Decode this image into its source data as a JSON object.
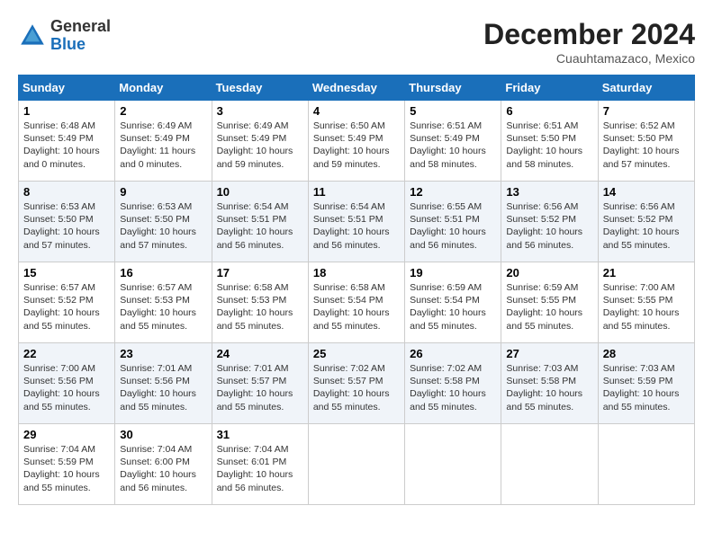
{
  "header": {
    "logo_line1": "General",
    "logo_line2": "Blue",
    "month_title": "December 2024",
    "location": "Cuauhtamazaco, Mexico"
  },
  "weekdays": [
    "Sunday",
    "Monday",
    "Tuesday",
    "Wednesday",
    "Thursday",
    "Friday",
    "Saturday"
  ],
  "weeks": [
    [
      {
        "day": "1",
        "sunrise": "6:48 AM",
        "sunset": "5:49 PM",
        "daylight": "10 hours and 0 minutes."
      },
      {
        "day": "2",
        "sunrise": "6:49 AM",
        "sunset": "5:49 PM",
        "daylight": "11 hours and 0 minutes."
      },
      {
        "day": "3",
        "sunrise": "6:49 AM",
        "sunset": "5:49 PM",
        "daylight": "10 hours and 59 minutes."
      },
      {
        "day": "4",
        "sunrise": "6:50 AM",
        "sunset": "5:49 PM",
        "daylight": "10 hours and 59 minutes."
      },
      {
        "day": "5",
        "sunrise": "6:51 AM",
        "sunset": "5:49 PM",
        "daylight": "10 hours and 58 minutes."
      },
      {
        "day": "6",
        "sunrise": "6:51 AM",
        "sunset": "5:50 PM",
        "daylight": "10 hours and 58 minutes."
      },
      {
        "day": "7",
        "sunrise": "6:52 AM",
        "sunset": "5:50 PM",
        "daylight": "10 hours and 57 minutes."
      }
    ],
    [
      {
        "day": "8",
        "sunrise": "6:53 AM",
        "sunset": "5:50 PM",
        "daylight": "10 hours and 57 minutes."
      },
      {
        "day": "9",
        "sunrise": "6:53 AM",
        "sunset": "5:50 PM",
        "daylight": "10 hours and 57 minutes."
      },
      {
        "day": "10",
        "sunrise": "6:54 AM",
        "sunset": "5:51 PM",
        "daylight": "10 hours and 56 minutes."
      },
      {
        "day": "11",
        "sunrise": "6:54 AM",
        "sunset": "5:51 PM",
        "daylight": "10 hours and 56 minutes."
      },
      {
        "day": "12",
        "sunrise": "6:55 AM",
        "sunset": "5:51 PM",
        "daylight": "10 hours and 56 minutes."
      },
      {
        "day": "13",
        "sunrise": "6:56 AM",
        "sunset": "5:52 PM",
        "daylight": "10 hours and 56 minutes."
      },
      {
        "day": "14",
        "sunrise": "6:56 AM",
        "sunset": "5:52 PM",
        "daylight": "10 hours and 55 minutes."
      }
    ],
    [
      {
        "day": "15",
        "sunrise": "6:57 AM",
        "sunset": "5:52 PM",
        "daylight": "10 hours and 55 minutes."
      },
      {
        "day": "16",
        "sunrise": "6:57 AM",
        "sunset": "5:53 PM",
        "daylight": "10 hours and 55 minutes."
      },
      {
        "day": "17",
        "sunrise": "6:58 AM",
        "sunset": "5:53 PM",
        "daylight": "10 hours and 55 minutes."
      },
      {
        "day": "18",
        "sunrise": "6:58 AM",
        "sunset": "5:54 PM",
        "daylight": "10 hours and 55 minutes."
      },
      {
        "day": "19",
        "sunrise": "6:59 AM",
        "sunset": "5:54 PM",
        "daylight": "10 hours and 55 minutes."
      },
      {
        "day": "20",
        "sunrise": "6:59 AM",
        "sunset": "5:55 PM",
        "daylight": "10 hours and 55 minutes."
      },
      {
        "day": "21",
        "sunrise": "7:00 AM",
        "sunset": "5:55 PM",
        "daylight": "10 hours and 55 minutes."
      }
    ],
    [
      {
        "day": "22",
        "sunrise": "7:00 AM",
        "sunset": "5:56 PM",
        "daylight": "10 hours and 55 minutes."
      },
      {
        "day": "23",
        "sunrise": "7:01 AM",
        "sunset": "5:56 PM",
        "daylight": "10 hours and 55 minutes."
      },
      {
        "day": "24",
        "sunrise": "7:01 AM",
        "sunset": "5:57 PM",
        "daylight": "10 hours and 55 minutes."
      },
      {
        "day": "25",
        "sunrise": "7:02 AM",
        "sunset": "5:57 PM",
        "daylight": "10 hours and 55 minutes."
      },
      {
        "day": "26",
        "sunrise": "7:02 AM",
        "sunset": "5:58 PM",
        "daylight": "10 hours and 55 minutes."
      },
      {
        "day": "27",
        "sunrise": "7:03 AM",
        "sunset": "5:58 PM",
        "daylight": "10 hours and 55 minutes."
      },
      {
        "day": "28",
        "sunrise": "7:03 AM",
        "sunset": "5:59 PM",
        "daylight": "10 hours and 55 minutes."
      }
    ],
    [
      {
        "day": "29",
        "sunrise": "7:04 AM",
        "sunset": "5:59 PM",
        "daylight": "10 hours and 55 minutes."
      },
      {
        "day": "30",
        "sunrise": "7:04 AM",
        "sunset": "6:00 PM",
        "daylight": "10 hours and 56 minutes."
      },
      {
        "day": "31",
        "sunrise": "7:04 AM",
        "sunset": "6:01 PM",
        "daylight": "10 hours and 56 minutes."
      },
      null,
      null,
      null,
      null
    ]
  ]
}
